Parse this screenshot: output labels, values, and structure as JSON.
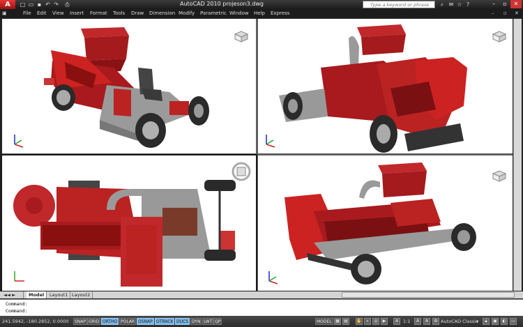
{
  "titlebar": {
    "app_button": "A",
    "title": "AutoCAD 2010    projeson3.dwg",
    "search_placeholder": "Type a keyword or phrase",
    "quick_access_icons": [
      "new-icon",
      "open-icon",
      "save-icon",
      "undo-icon",
      "redo-icon",
      "print-icon"
    ]
  },
  "menubar": {
    "items": [
      "File",
      "Edit",
      "View",
      "Insert",
      "Format",
      "Tools",
      "Draw",
      "Dimension",
      "Modify",
      "Parametric",
      "Window",
      "Help",
      "Express"
    ]
  },
  "tabs": {
    "items": [
      "Model",
      "Layout1",
      "Layout2"
    ]
  },
  "command": {
    "lines": [
      "Command:",
      "Command:"
    ]
  },
  "status": {
    "coords": "241.5942, -180.2852, 0.0000",
    "toggles": [
      "SNAP",
      "GRID",
      "ORTHO",
      "POLAR",
      "OSNAP",
      "OTRACK",
      "DUCS",
      "DYN",
      "LWT",
      "QP"
    ],
    "active_toggles": [
      "ORTHO",
      "OSNAP",
      "OTRACK",
      "DUCS"
    ],
    "model_label": "MODEL",
    "scale": "1:1",
    "workspace": "AutoCAD Classic"
  },
  "colors": {
    "body_red": "#b0171b",
    "body_dark_red": "#7a0f12",
    "metal_gray": "#a3a3a3",
    "tire_dark": "#2a2a2a",
    "status_active": "#7db5dc"
  }
}
